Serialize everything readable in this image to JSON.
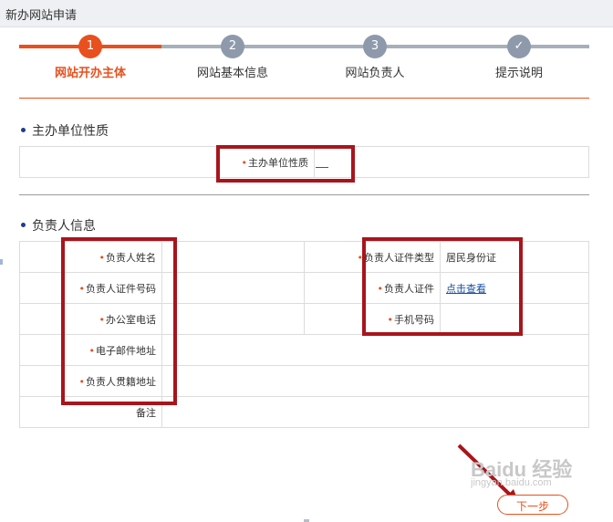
{
  "window": {
    "title": "新办网站申请"
  },
  "steps": [
    {
      "num": "1",
      "label": "网站开办主体",
      "state": "active"
    },
    {
      "num": "2",
      "label": "网站基本信息",
      "state": "pending"
    },
    {
      "num": "3",
      "label": "网站负责人",
      "state": "pending"
    },
    {
      "num": "✓",
      "label": "提示说明",
      "state": "pending"
    }
  ],
  "colors": {
    "accent": "#e8501e",
    "pending": "#8e9aab",
    "annotation": "#a8151b",
    "link": "#1a4fa0"
  },
  "section1": {
    "title": "主办单位性质",
    "label": "主办单位性质",
    "value": "—"
  },
  "section2": {
    "title": "负责人信息",
    "left_labels": [
      "负责人姓名",
      "负责人证件号码",
      "办公室电话",
      "电子邮件地址",
      "负责人贯籍地址"
    ],
    "remark_label": "备注",
    "right_rows": [
      {
        "label": "负责人证件类型",
        "value": "居民身份证",
        "link": false
      },
      {
        "label": "负责人证件",
        "value": "点击查看",
        "link": true
      },
      {
        "label": "手机号码",
        "value": "",
        "link": false
      }
    ]
  },
  "footer": {
    "next_label": "下一步",
    "watermark": "Baidu 经验",
    "watermark_sub": "jingyan.baidu.com"
  }
}
